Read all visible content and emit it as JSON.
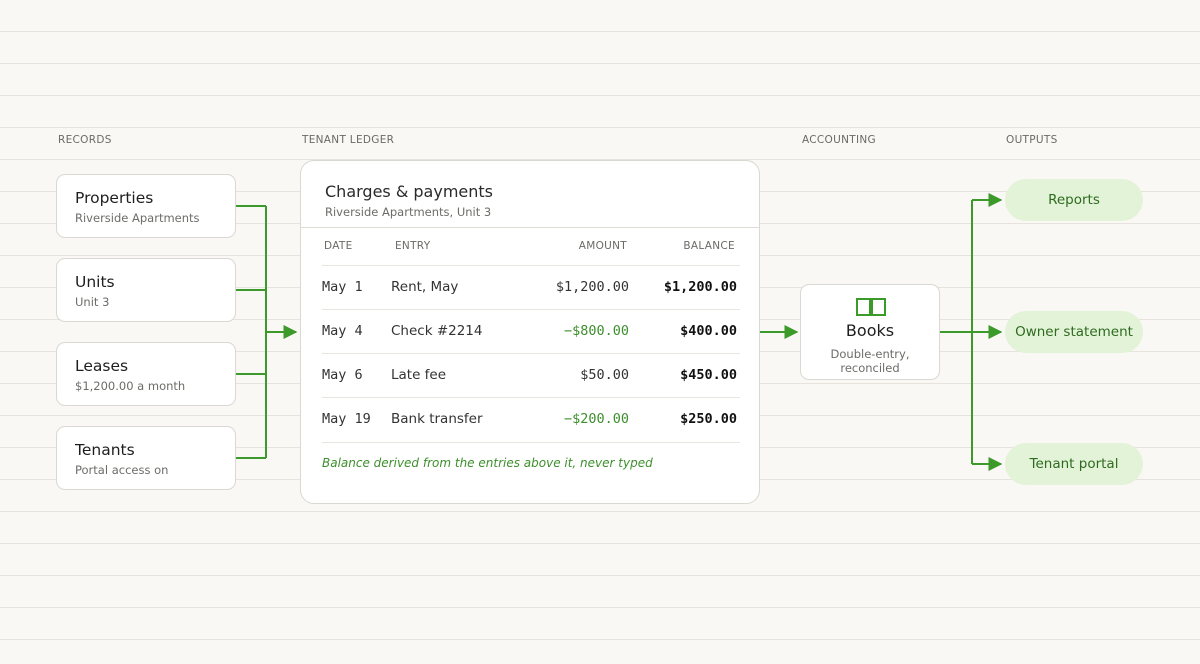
{
  "columns": {
    "records": "RECORDS",
    "ledger": "TENANT LEDGER",
    "accounting": "ACCOUNTING",
    "outputs": "OUTPUTS"
  },
  "records": [
    {
      "title": "Properties",
      "subtitle": "Riverside Apartments"
    },
    {
      "title": "Units",
      "subtitle": "Unit 3"
    },
    {
      "title": "Leases",
      "subtitle": "$1,200.00 a month"
    },
    {
      "title": "Tenants",
      "subtitle": "Portal access on"
    }
  ],
  "ledger": {
    "title": "Charges & payments",
    "subtitle": "Riverside Apartments, Unit 3",
    "headers": {
      "date": "DATE",
      "entry": "ENTRY",
      "amount": "AMOUNT",
      "balance": "BALANCE"
    },
    "rows": [
      {
        "date": "May 1",
        "entry": "Rent, May",
        "amount": "$1,200.00",
        "balance": "$1,200.00",
        "negative": false
      },
      {
        "date": "May 4",
        "entry": "Check #2214",
        "amount": "−$800.00",
        "balance": "$400.00",
        "negative": true
      },
      {
        "date": "May 6",
        "entry": "Late fee",
        "amount": "$50.00",
        "balance": "$450.00",
        "negative": false
      },
      {
        "date": "May 19",
        "entry": "Bank transfer",
        "amount": "−$200.00",
        "balance": "$250.00",
        "negative": true
      }
    ],
    "note": "Balance derived from the entries above it, never typed"
  },
  "books": {
    "title": "Books",
    "subtitle": "Double-entry, reconciled",
    "icon": "open-book-icon"
  },
  "outputs": [
    {
      "label": "Reports"
    },
    {
      "label": "Owner statement"
    },
    {
      "label": "Tenant portal"
    }
  ],
  "colors": {
    "accent": "#3c9a2a",
    "accent_text": "#2f6b1f",
    "pill_bg": "#e3f3d8",
    "negative_amount": "#3d8f2c"
  }
}
